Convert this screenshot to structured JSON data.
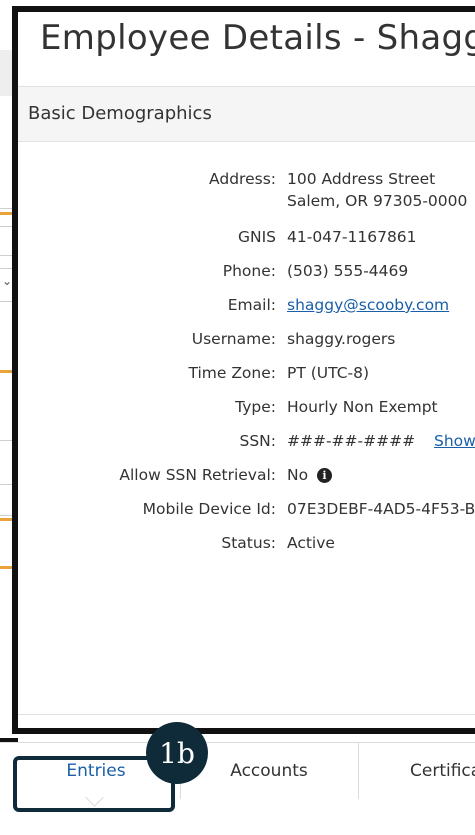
{
  "modal": {
    "title": "Employee Details - Shaggy Rogers",
    "section_title": "Basic Demographics"
  },
  "fields": [
    {
      "label": "Address:",
      "value": "100 Address Street",
      "value2": "Salem, OR 97305-0000"
    },
    {
      "label": "GNIS",
      "value": "41-047-1167861"
    },
    {
      "label": "Phone:",
      "value": "(503) 555-4469"
    },
    {
      "label": "Email:",
      "value": "shaggy@scooby.com"
    },
    {
      "label": "Username:",
      "value": "shaggy.rogers"
    },
    {
      "label": "Time Zone:",
      "value": "PT (UTC-8)"
    },
    {
      "label": "Type:",
      "value": "Hourly Non Exempt"
    },
    {
      "label": "SSN:",
      "value": "###-##-####",
      "action": "Show"
    },
    {
      "label": "Allow SSN Retrieval:",
      "value": "No"
    },
    {
      "label": "Mobile Device Id:",
      "value": "07E3DEBF-4AD5-4F53-B"
    },
    {
      "label": "Status:",
      "value": "Active"
    }
  ],
  "tabs": [
    {
      "label": "Entries",
      "active": true
    },
    {
      "label": "Accounts",
      "active": false
    },
    {
      "label": "Certifica",
      "active": false
    }
  ],
  "annotation": {
    "badge": "1b"
  },
  "colors": {
    "link": "#1a5fa8",
    "callout": "#0f2b3a",
    "accent_orange": "#e8a33a"
  },
  "icons": {
    "ssn_info": "info-circle-icon"
  }
}
